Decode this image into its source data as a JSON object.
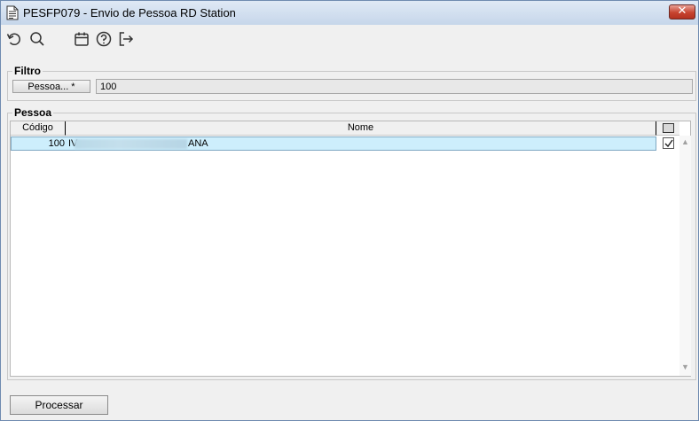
{
  "window": {
    "title": "PESFP079 - Envio de Pessoa RD Station",
    "close_label": "✕"
  },
  "toolbar": {
    "buttons": [
      {
        "name": "refresh",
        "icon": "refresh-icon"
      },
      {
        "name": "search",
        "icon": "search-icon"
      },
      {
        "name": "calendar",
        "icon": "calendar-icon"
      },
      {
        "name": "help",
        "icon": "help-icon"
      },
      {
        "name": "exit",
        "icon": "exit-icon"
      }
    ]
  },
  "filtro": {
    "legend": "Filtro",
    "pessoa_button_label": "Pessoa... *",
    "pessoa_value": "100"
  },
  "pessoa": {
    "legend": "Pessoa",
    "columns": {
      "codigo": "Código",
      "nome": "Nome"
    },
    "rows": [
      {
        "codigo": "100",
        "nome_visible_start": "IV",
        "nome_visible_end": "ANA",
        "selected": true
      }
    ]
  },
  "actions": {
    "processar_label": "Processar"
  },
  "colors": {
    "selected_row": "#cdeefc",
    "close_button": "#c7432f",
    "titlebar": "#c6d6ea"
  }
}
